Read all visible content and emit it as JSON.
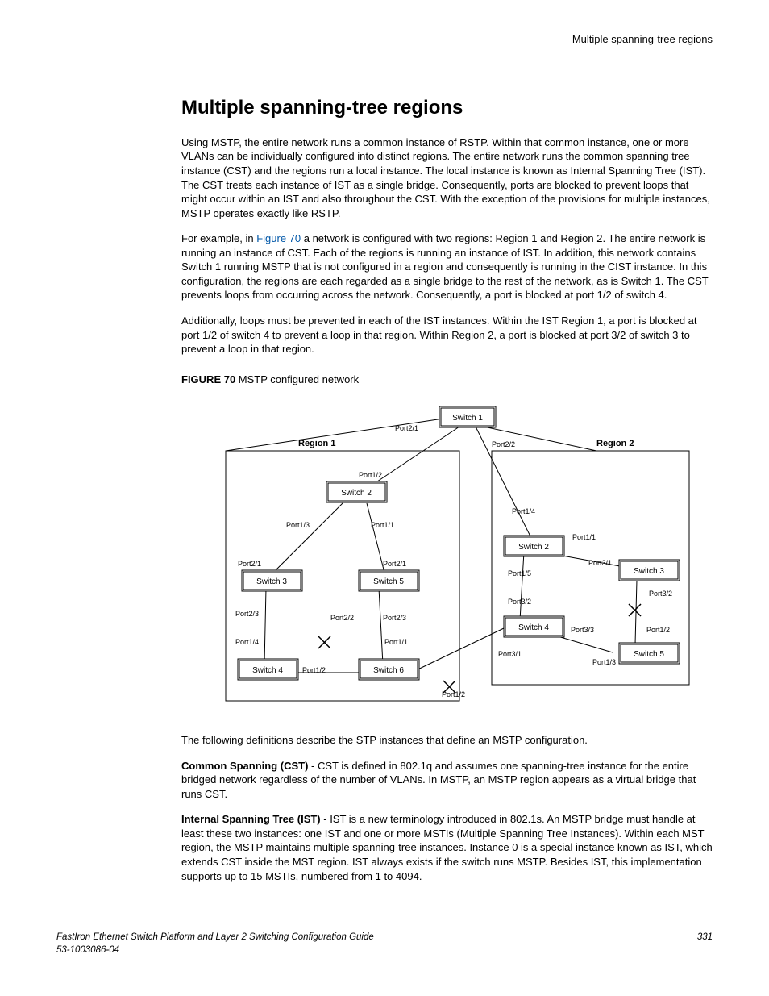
{
  "header": {
    "running_title": "Multiple spanning-tree regions"
  },
  "title": "Multiple spanning-tree regions",
  "paragraphs": {
    "p1": "Using MSTP, the entire network runs a common instance of RSTP. Within that common instance, one or more VLANs can be individually configured into distinct regions. The entire network runs the common spanning tree instance (CST) and the regions run a local instance. The local instance is known as Internal Spanning Tree (IST). The CST treats each instance of IST as a single bridge. Consequently, ports are blocked to prevent loops that might occur within an IST and also throughout the CST. With the exception of the provisions for multiple instances, MSTP operates exactly like RSTP.",
    "p2_pre": "For example, in ",
    "p2_link": "Figure 70",
    "p2_post": " a network is configured with two regions: Region 1 and Region 2. The entire network is running an instance of CST. Each of the regions is running an instance of IST. In addition, this network contains Switch 1 running MSTP that is not configured in a region and consequently is running in the CIST instance. In this configuration, the regions are each regarded as a single bridge to the rest of the network, as is Switch 1. The CST prevents loops from occurring across the network. Consequently, a port is blocked at port 1/2 of switch 4.",
    "p3": "Additionally, loops must be prevented in each of the IST instances. Within the IST Region 1, a port is blocked at port 1/2 of switch 4 to prevent a loop in that region. Within Region 2, a port is blocked at port 3/2 of switch 3 to prevent a loop in that region.",
    "p4": "The following definitions describe the STP instances that define an MSTP configuration.",
    "cst_label": "Common Spanning (CST)",
    "cst_text": " - CST is defined in 802.1q and assumes one spanning-tree instance for the entire bridged network regardless of the number of VLANs. In MSTP, an MSTP region appears as a virtual bridge that runs CST.",
    "ist_label": "Internal Spanning Tree (IST)",
    "ist_text": " - IST is a new terminology introduced in 802.1s. An MSTP bridge must handle at least these two instances: one IST and one or more MSTIs (Multiple Spanning Tree Instances). Within each MST region, the MSTP maintains multiple spanning-tree instances. Instance 0 is a special instance known as IST, which extends CST inside the MST region. IST always exists if the switch runs MSTP. Besides IST, this implementation supports up to 15 MSTIs, numbered from 1 to 4094."
  },
  "figure": {
    "caption_label": "FIGURE 70",
    "caption_text": " MSTP configured network",
    "labels": {
      "region1": "Region 1",
      "region2": "Region 2",
      "switch1": "Switch 1",
      "r1_switch2": "Switch 2",
      "r1_switch3": "Switch 3",
      "r1_switch4": "Switch 4",
      "r1_switch5": "Switch 5",
      "r1_switch6": "Switch 6",
      "r2_switch2": "Switch 2",
      "r2_switch3": "Switch 3",
      "r2_switch4": "Switch 4",
      "r2_switch5": "Switch 5",
      "p_2_1": "Port2/1",
      "p_2_2": "Port2/2",
      "p_1_2a": "Port1/2",
      "p_1_3": "Port1/3",
      "p_1_1a": "Port1/1",
      "p_2_1b": "Port2/1",
      "p_2_1c": "Port2/1",
      "p_2_3": "Port2/3",
      "p_2_2b": "Port2/2",
      "p_2_3b": "Port2/3",
      "p_1_4": "Port1/4",
      "p_1_1b": "Port1/1",
      "p_1_2b": "Port1/2",
      "p_1_2c": "Port1/2",
      "r2_p_1_4": "Port1/4",
      "r2_p_1_1": "Port1/1",
      "r2_p_1_5": "Port1/5",
      "r2_p_3_1": "Port3/1",
      "r2_p_3_2a": "Port3/2",
      "r2_p_3_2b": "Port3/2",
      "r2_p_3_3": "Port3/3",
      "r2_p_1_2": "Port1/2",
      "r2_p_3_1b": "Port3/1",
      "r2_p_1_3": "Port1/3"
    }
  },
  "footer": {
    "doc_title": "FastIron Ethernet Switch Platform and Layer 2 Switching Configuration Guide",
    "doc_number": "53-1003086-04",
    "page": "331"
  }
}
